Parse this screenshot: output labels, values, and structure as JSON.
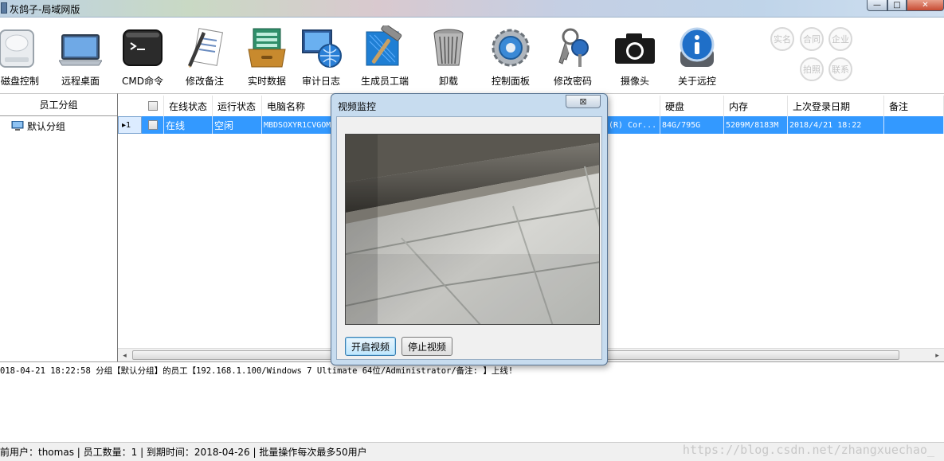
{
  "window": {
    "title": "灰鸽子-局域网版",
    "controls": {
      "minimize": "—",
      "maximize": "□",
      "close": "✕"
    }
  },
  "toolbar": {
    "items": [
      {
        "label": "磁盘控制",
        "icon": "disk-icon"
      },
      {
        "label": "远程桌面",
        "icon": "laptop-icon"
      },
      {
        "label": "CMD命令",
        "icon": "terminal-icon"
      },
      {
        "label": "修改备注",
        "icon": "edit-note-icon"
      },
      {
        "label": "实时数据",
        "icon": "data-cabinet-icon"
      },
      {
        "label": "审计日志",
        "icon": "audit-globe-icon"
      },
      {
        "label": "生成员工端",
        "icon": "build-hammer-icon"
      },
      {
        "label": "卸载",
        "icon": "trash-bin-icon"
      },
      {
        "label": "控制面板",
        "icon": "gear-icon"
      },
      {
        "label": "修改密码",
        "icon": "keys-icon"
      },
      {
        "label": "摄像头",
        "icon": "camera-icon"
      },
      {
        "label": "关于远控",
        "icon": "info-icon"
      }
    ],
    "badges": [
      "实名",
      "合同",
      "企业",
      "拍照",
      "联系"
    ]
  },
  "tree": {
    "header": "员工分组",
    "items": [
      {
        "label": "默认分组",
        "icon": "computer-icon"
      }
    ]
  },
  "grid": {
    "columns": [
      "在线状态",
      "运行状态",
      "电脑名称",
      "硬盘",
      "内存",
      "上次登录日期",
      "备注"
    ],
    "rows": [
      {
        "index": "1",
        "online_status": "在线",
        "run_status": "空闲",
        "computer_name": "MBDSOXYR1CVGOM",
        "cpu_fragment": "(R) Cor...",
        "disk": "84G/795G",
        "memory": "5209M/8183M",
        "last_login": "2018/4/21 18:22",
        "note": ""
      }
    ]
  },
  "dialog": {
    "title": "视频监控",
    "close_label": "⊠",
    "start_button": "开启视频",
    "stop_button": "停止视频"
  },
  "log": {
    "lines": [
      "018-04-21  18:22:58 分组【默认分组】的员工【192.168.1.100/Windows 7 Ultimate 64位/Administrator/备注: 】上线!"
    ]
  },
  "status": {
    "text": "前用户：thomas | 员工数量：1 | 到期时间：2018-04-26 | 批量操作每次最多50用户",
    "watermark": "https://blog.csdn.net/zhangxuechao_"
  }
}
